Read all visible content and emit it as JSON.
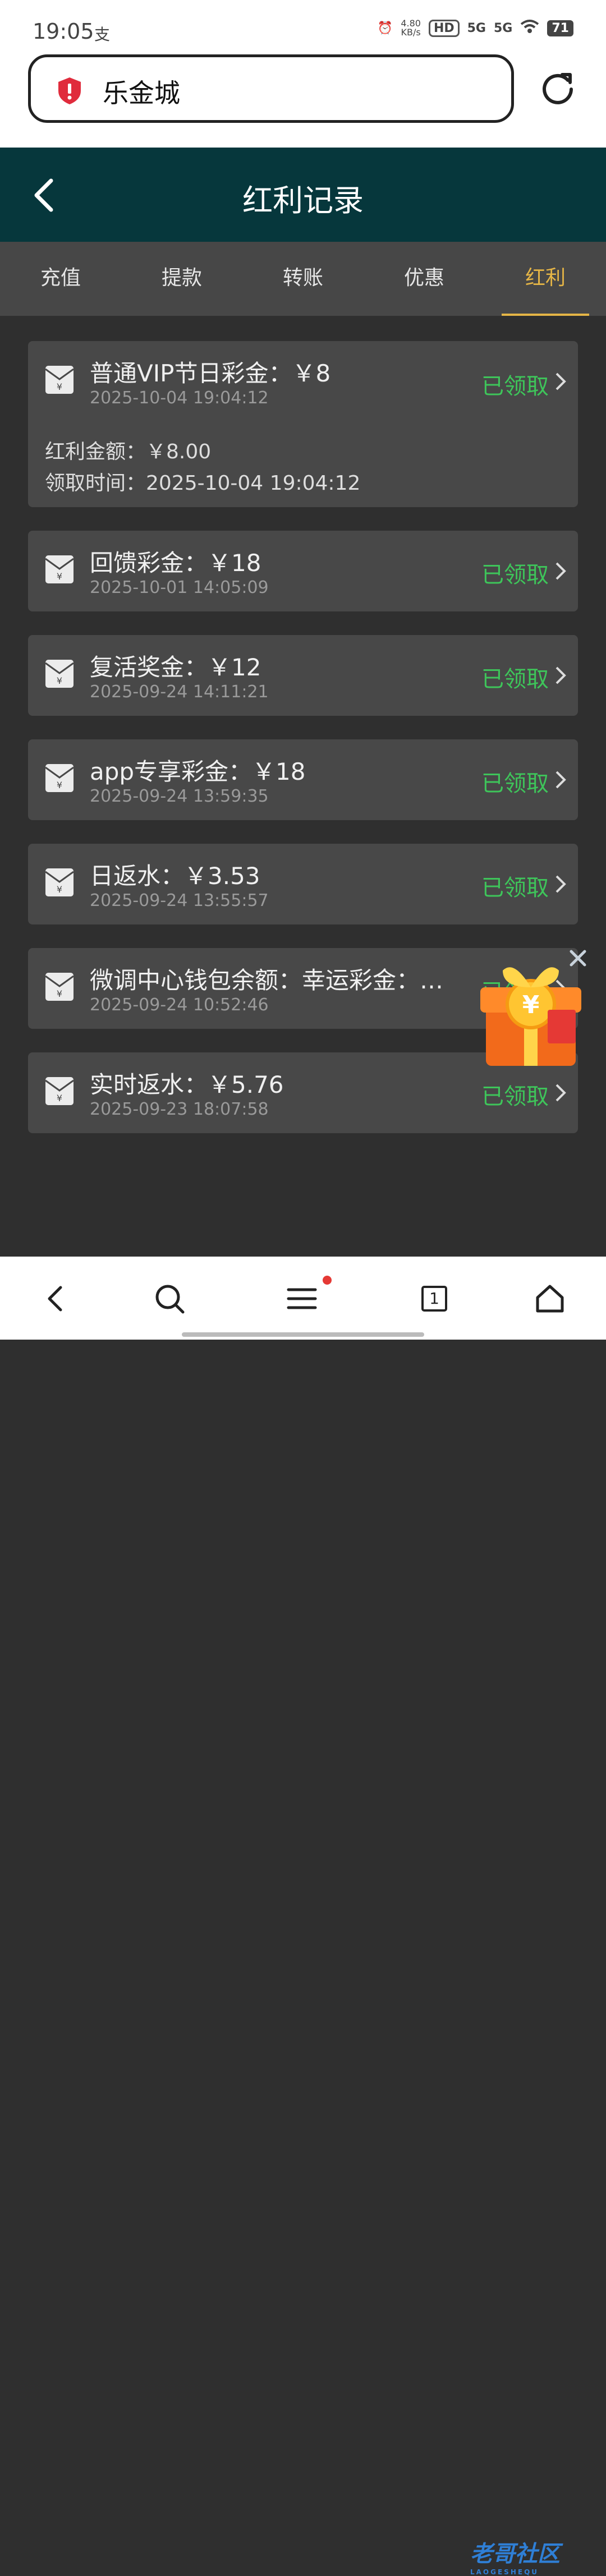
{
  "status_bar": {
    "time": "19:05",
    "pay_icon": "支",
    "speed": "4.80",
    "speed_unit": "KB/s",
    "hd": "HD",
    "net1": "5G",
    "net2": "5G",
    "battery": "71"
  },
  "browser": {
    "url_text": "乐金城"
  },
  "header": {
    "title": "红利记录"
  },
  "tabs": [
    {
      "label": "充值"
    },
    {
      "label": "提款"
    },
    {
      "label": "转账"
    },
    {
      "label": "优惠"
    },
    {
      "label": "红利"
    }
  ],
  "records": [
    {
      "title": "普通VIP节日彩金：￥8",
      "date": "2025-10-04 19:04:12",
      "status": "已领取",
      "detail_amount": "红利金额：￥8.00",
      "detail_time": "领取时间：2025-10-04 19:04:12"
    },
    {
      "title": "回馈彩金：￥18",
      "date": "2025-10-01 14:05:09",
      "status": "已领取"
    },
    {
      "title": "复活奖金：￥12",
      "date": "2025-09-24 14:11:21",
      "status": "已领取"
    },
    {
      "title": "app专享彩金：￥18",
      "date": "2025-09-24 13:59:35",
      "status": "已领取"
    },
    {
      "title": "日返水：￥3.53",
      "date": "2025-09-24 13:55:57",
      "status": "已领取"
    },
    {
      "title": "微调中心钱包余额：幸运彩金：…",
      "date": "2025-09-24 10:52:46",
      "status": "已领取"
    },
    {
      "title": "实时返水：￥5.76",
      "date": "2025-09-23 18:07:58",
      "status": "已领取"
    }
  ],
  "nav": {
    "tab_count": "1"
  },
  "watermark": {
    "text": "老哥社区",
    "sub": "LAOGESHEQU"
  }
}
